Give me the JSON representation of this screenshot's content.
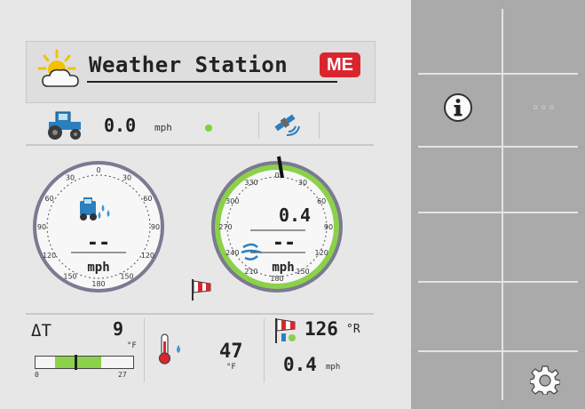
{
  "header": {
    "title": "Weather Station",
    "logo_text": "ME",
    "weather_icon": "partly-sunny-icon"
  },
  "speed_row": {
    "vehicle_icon": "tractor-icon",
    "speed_value": "0.0",
    "speed_unit": "mph",
    "gps_status_color": "#7fd23a",
    "gps_icon": "satellite-icon"
  },
  "gauges": {
    "tick_labels": [
      "0",
      "30",
      "60",
      "90",
      "120",
      "150",
      "180",
      "150",
      "120",
      "90",
      "60",
      "30"
    ],
    "vehicle_gauge": {
      "value": "--",
      "unit": "mph",
      "icon": "sprayer-icon"
    },
    "wind_gauge": {
      "ticks_left": [
        "330",
        "300",
        "270",
        "240",
        "210"
      ],
      "value_top": "0.4",
      "value": "--",
      "unit": "mph",
      "icon": "wind-icon",
      "ring_color": "#8cd14a"
    },
    "windsock_icon": "windsock-icon"
  },
  "bottom": {
    "delta_t": {
      "label": "ΔT",
      "value": "9",
      "unit": "°F",
      "bar_min": "0",
      "bar_max": "27"
    },
    "temperature": {
      "value": "47",
      "unit": "°F",
      "icon": "thermometer-icon"
    },
    "wind": {
      "direction_value": "126",
      "direction_unit": "°R",
      "speed_value": "0.4",
      "speed_unit": "mph",
      "icon": "windsock-icon"
    }
  },
  "sidebar": {
    "info_icon": "info-icon",
    "more_label": "◦◦◦",
    "settings_icon": "gear-icon"
  }
}
